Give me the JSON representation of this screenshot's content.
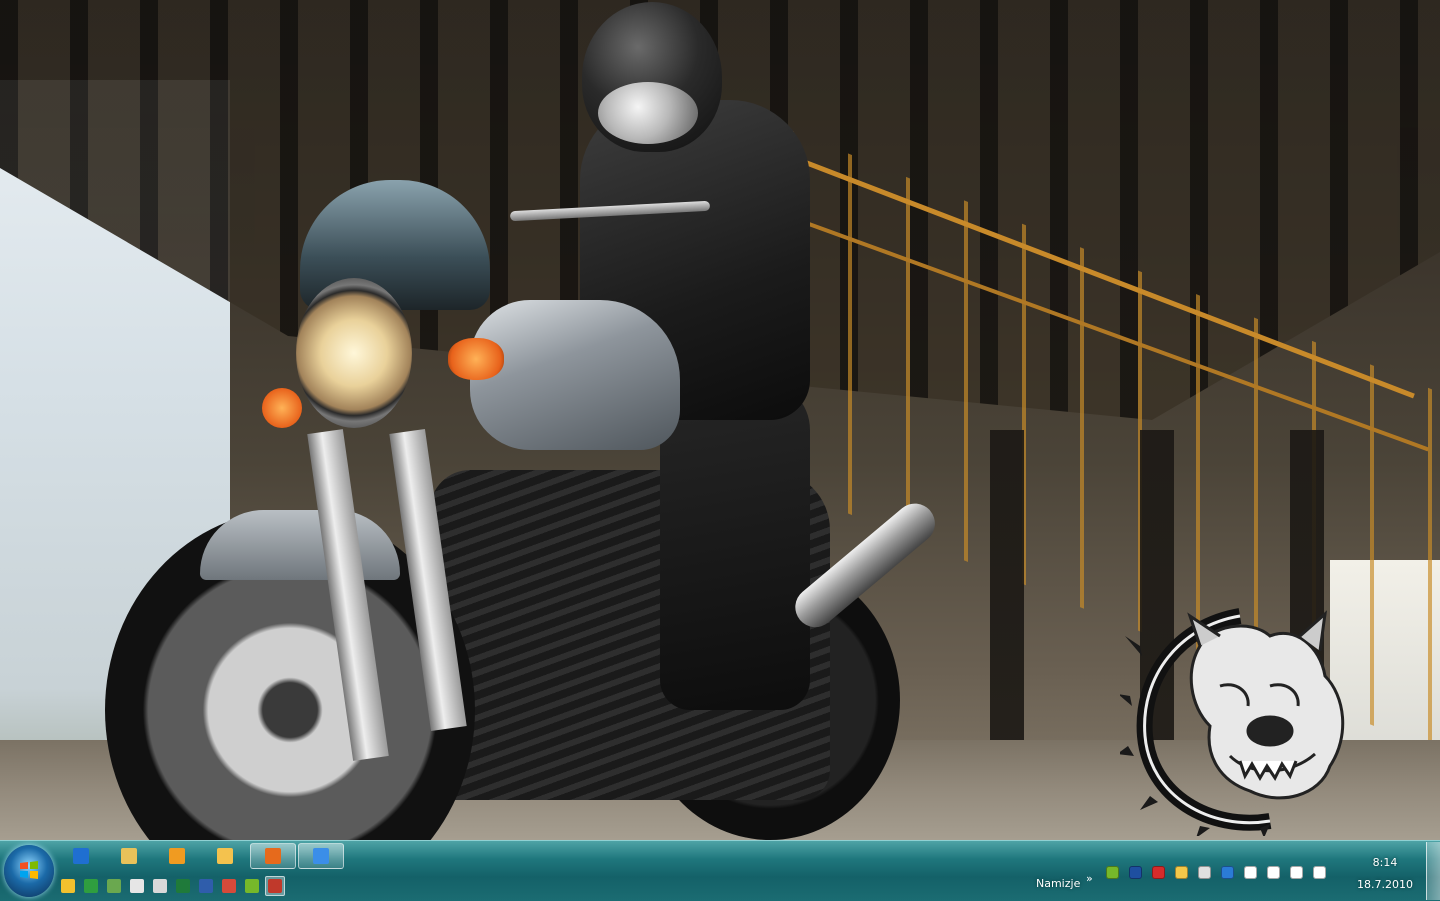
{
  "wallpaper": {
    "description_icons": [
      "motorcycle-rider",
      "bulldog-emblem"
    ]
  },
  "taskbar": {
    "start_icon": "windows-orb-icon",
    "row1_buttons": [
      {
        "icon": "internet-explorer-icon",
        "color": "#1f6fd1",
        "active": false
      },
      {
        "icon": "explorer-folder-icon",
        "color": "#e8c25a",
        "active": false
      },
      {
        "icon": "media-player-icon",
        "color": "#f09b21",
        "active": false
      },
      {
        "icon": "messenger-icon",
        "color": "#f4c24e",
        "active": false
      },
      {
        "icon": "firefox-icon",
        "color": "#e66a1c",
        "active": true
      },
      {
        "icon": "remote-desktop-icon",
        "color": "#3b8ee8",
        "active": true
      }
    ],
    "row2_buttons": [
      {
        "icon": "gadget-icon",
        "color": "#f2c12e"
      },
      {
        "icon": "project-icon",
        "color": "#2f9e3f"
      },
      {
        "icon": "pencil-icon",
        "color": "#6aa84f"
      },
      {
        "icon": "window-icon",
        "color": "#e6e6e6"
      },
      {
        "icon": "copy-icon",
        "color": "#d9d9d9"
      },
      {
        "icon": "excel-icon",
        "color": "#1f7a3a"
      },
      {
        "icon": "word-icon",
        "color": "#2f5dab"
      },
      {
        "icon": "outlook-icon",
        "color": "#d64a3a"
      },
      {
        "icon": "messenger-people-icon",
        "color": "#76b82a"
      },
      {
        "icon": "snipping-tool-icon",
        "color": "#c0392b"
      }
    ],
    "desktop_label": "Namizje",
    "chevron": "»",
    "tray_icons": [
      {
        "icon": "skype-icon",
        "color": "#76b82a"
      },
      {
        "icon": "bluetooth-icon",
        "color": "#1e4fa0"
      },
      {
        "icon": "antivirus-icon",
        "color": "#d62b2b"
      },
      {
        "icon": "messenger-tray-icon",
        "color": "#f3c84a"
      },
      {
        "icon": "printer-icon",
        "color": "#e0e0e0"
      },
      {
        "icon": "network-globe-icon",
        "color": "#2b7bd6"
      },
      {
        "icon": "action-center-flag-icon",
        "color": "#ffffff"
      },
      {
        "icon": "battery-icon",
        "color": "#ffffff"
      },
      {
        "icon": "signal-bars-icon",
        "color": "#ffffff"
      },
      {
        "icon": "volume-icon",
        "color": "#ffffff"
      }
    ],
    "clock": {
      "time": "8:14",
      "date": "18.7.2010"
    }
  }
}
